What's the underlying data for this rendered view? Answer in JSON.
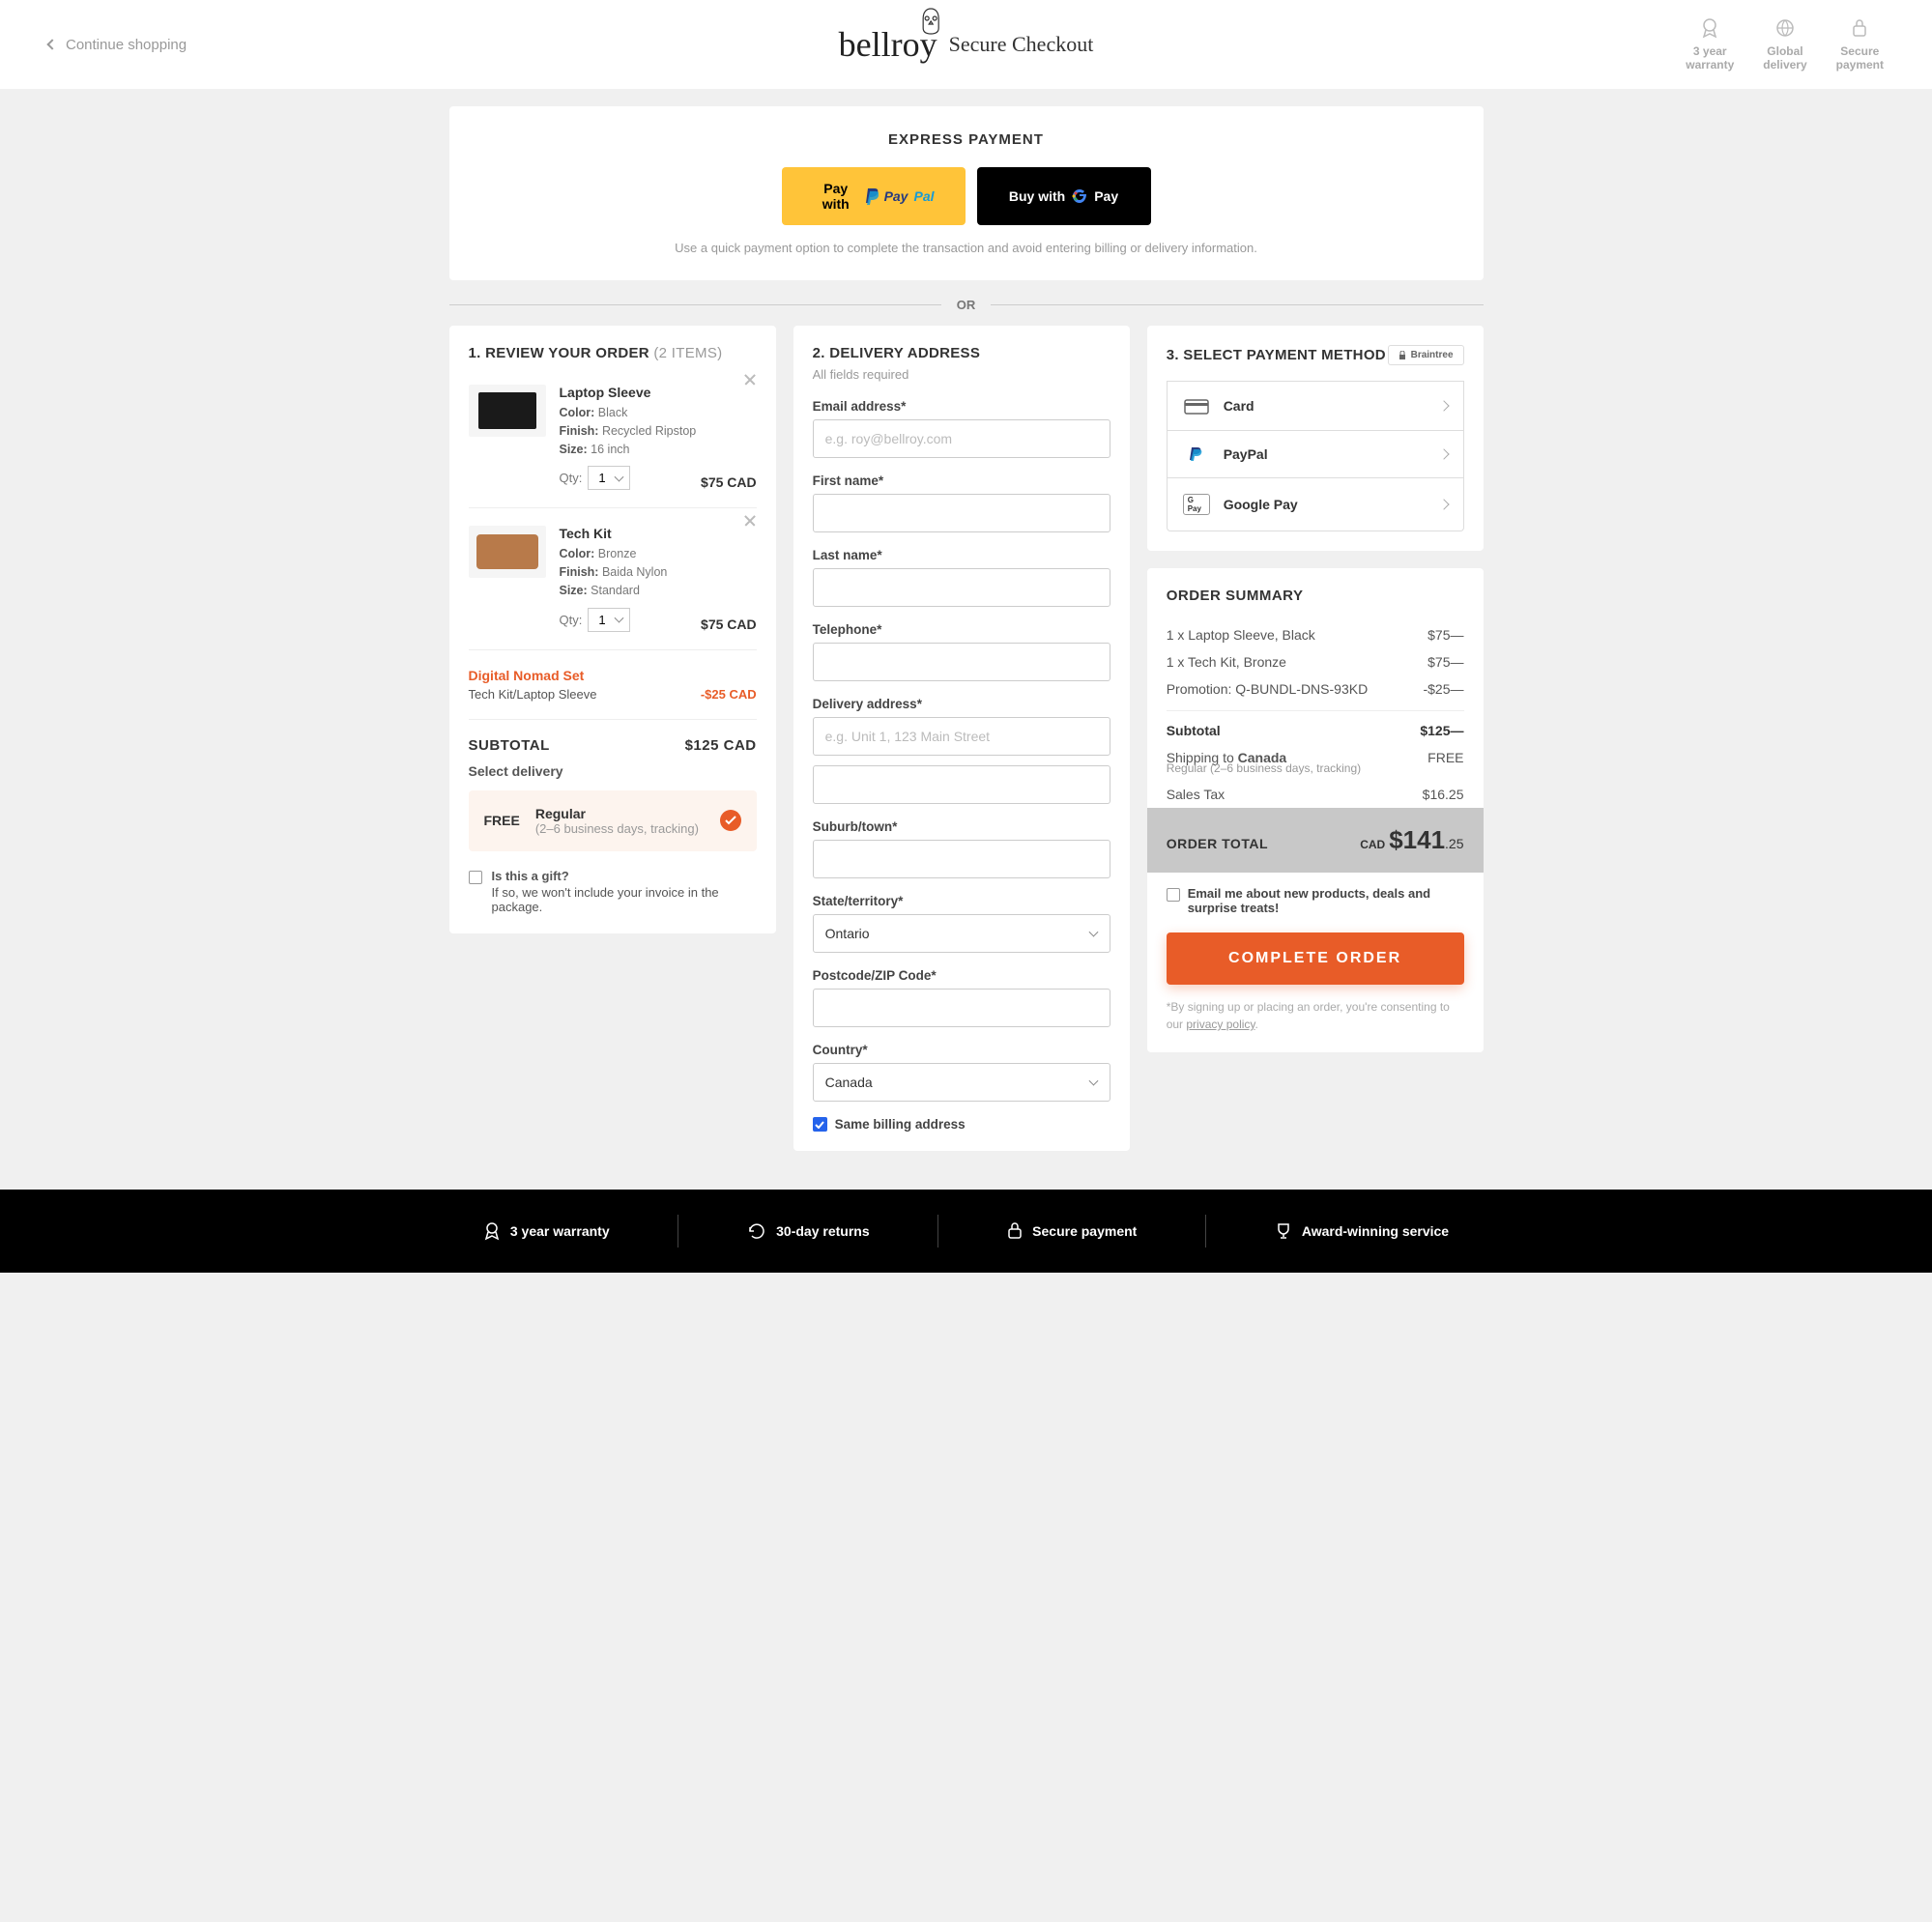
{
  "header": {
    "continue": "Continue shopping",
    "logo": "bellroy",
    "secure": "Secure Checkout",
    "badges": [
      {
        "line1": "3 year",
        "line2": "warranty"
      },
      {
        "line1": "Global",
        "line2": "delivery"
      },
      {
        "line1": "Secure",
        "line2": "payment"
      }
    ]
  },
  "express": {
    "title": "EXPRESS PAYMENT",
    "paypal_prefix": "Pay with",
    "paypal_brand1": "Pay",
    "paypal_brand2": "Pal",
    "gpay_prefix": "Buy with",
    "gpay_brand": "Pay",
    "hint": "Use a quick payment option to complete the transaction and avoid entering billing or delivery information."
  },
  "or": "OR",
  "review": {
    "title": "1. REVIEW YOUR ORDER",
    "count": "(2 ITEMS)",
    "items": [
      {
        "name": "Laptop Sleeve",
        "color_label": "Color:",
        "color": "Black",
        "finish_label": "Finish:",
        "finish": "Recycled Ripstop",
        "size_label": "Size:",
        "size": "16 inch",
        "qty_label": "Qty:",
        "qty": "1",
        "price": "$75 CAD"
      },
      {
        "name": "Tech Kit",
        "color_label": "Color:",
        "color": "Bronze",
        "finish_label": "Finish:",
        "finish": "Baida Nylon",
        "size_label": "Size:",
        "size": "Standard",
        "qty_label": "Qty:",
        "qty": "1",
        "price": "$75 CAD"
      }
    ],
    "promo": {
      "name": "Digital Nomad Set",
      "desc": "Tech Kit/Laptop Sleeve",
      "amount": "-$25 CAD"
    },
    "subtotal_label": "SUBTOTAL",
    "subtotal": "$125 CAD",
    "delivery_label": "Select delivery",
    "delivery": {
      "free": "FREE",
      "name": "Regular",
      "sub": "(2–6 business days, tracking)"
    },
    "gift": {
      "question": "Is this a gift?",
      "note": "If so, we won't include your invoice in the package."
    }
  },
  "delivery": {
    "title": "2. DELIVERY ADDRESS",
    "all_required": "All fields required",
    "email_label": "Email address*",
    "email_placeholder": "e.g. roy@bellroy.com",
    "first_label": "First name*",
    "last_label": "Last name*",
    "phone_label": "Telephone*",
    "addr_label": "Delivery address*",
    "addr_placeholder": "e.g. Unit 1, 123 Main Street",
    "suburb_label": "Suburb/town*",
    "state_label": "State/territory*",
    "state_value": "Ontario",
    "postcode_label": "Postcode/ZIP Code*",
    "country_label": "Country*",
    "country_value": "Canada",
    "same_billing": "Same billing address"
  },
  "payment": {
    "title": "3. SELECT PAYMENT METHOD",
    "braintree": "Braintree",
    "options": [
      "Card",
      "PayPal",
      "Google Pay"
    ]
  },
  "summary": {
    "title": "ORDER SUMMARY",
    "lines": [
      {
        "label": "1 x Laptop Sleeve, Black",
        "value": "$75—"
      },
      {
        "label": "1 x Tech Kit, Bronze",
        "value": "$75—"
      },
      {
        "label": "Promotion: Q-BUNDL-DNS-93KD",
        "value": "-$25—"
      }
    ],
    "subtotal_label": "Subtotal",
    "subtotal_value": "$125—",
    "shipping_label": "Shipping to ",
    "shipping_country": "Canada",
    "shipping_value": "FREE",
    "shipping_sub": "Regular (2–6 business days, tracking)",
    "tax_label": "Sales Tax",
    "tax_value": "$16.25",
    "total_label": "ORDER TOTAL",
    "total_currency": "CAD",
    "total_main": "$141",
    "total_cents": ".25",
    "email_opt": "Email me about new products, deals and surprise treats!",
    "complete": "COMPLETE ORDER",
    "consent_prefix": "*By signing up or placing an order, you're consenting to our ",
    "consent_link": "privacy policy",
    "consent_suffix": "."
  },
  "footer": {
    "items": [
      "3 year warranty",
      "30-day returns",
      "Secure payment",
      "Award-winning service"
    ]
  }
}
